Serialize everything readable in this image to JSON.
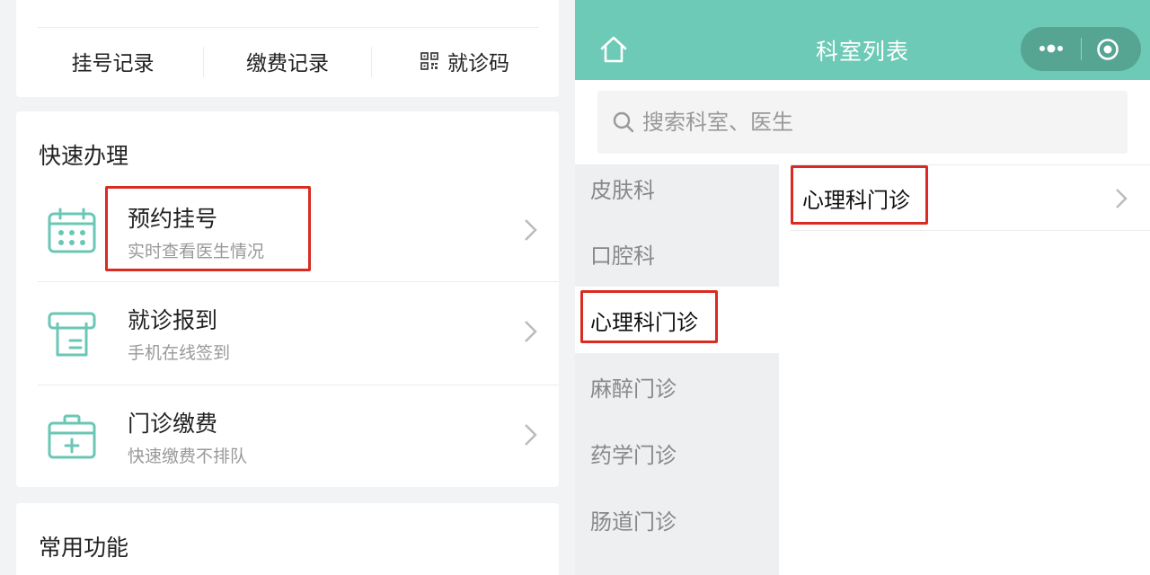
{
  "left": {
    "records": [
      {
        "label": "挂号记录"
      },
      {
        "label": "缴费记录"
      },
      {
        "label": "就诊码",
        "icon": "qr-code-icon"
      }
    ],
    "quick": {
      "title": "快速办理",
      "items": [
        {
          "title": "预约挂号",
          "subtitle": "实时查看医生情况",
          "icon": "calendar-icon"
        },
        {
          "title": "就诊报到",
          "subtitle": "手机在线签到",
          "icon": "receipt-printer-icon"
        },
        {
          "title": "门诊缴费",
          "subtitle": "快速缴费不排队",
          "icon": "medical-kit-icon"
        }
      ]
    },
    "common": {
      "title": "常用功能"
    }
  },
  "right": {
    "navbar": {
      "title": "科室列表",
      "bg_color": "#6ccab6"
    },
    "search": {
      "placeholder": "搜索科室、医生"
    },
    "departments": [
      {
        "label": "皮肤科",
        "active": false
      },
      {
        "label": "口腔科",
        "active": false
      },
      {
        "label": "心理科门诊",
        "active": true
      },
      {
        "label": "麻醉门诊",
        "active": false
      },
      {
        "label": "药学门诊",
        "active": false
      },
      {
        "label": "肠道门诊",
        "active": false
      }
    ],
    "sub_departments": [
      {
        "label": "心理科门诊"
      }
    ]
  },
  "colors": {
    "accent_teal": "#6ccab6",
    "icon_teal": "#6bc7b5",
    "highlight_red": "#d92b22"
  }
}
